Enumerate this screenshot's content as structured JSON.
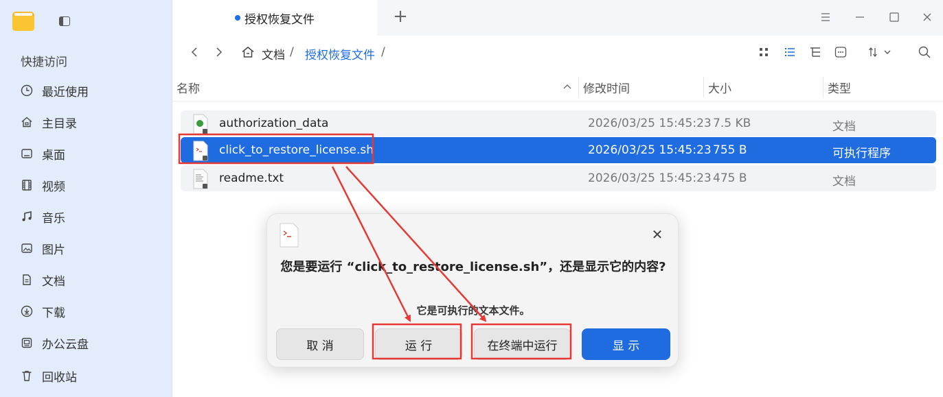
{
  "sidebar": {
    "heading": "快捷访问",
    "items": [
      {
        "label": "最近使用",
        "icon": "clock-icon"
      },
      {
        "label": "主目录",
        "icon": "home-icon"
      },
      {
        "label": "桌面",
        "icon": "desktop-icon"
      },
      {
        "label": "视频",
        "icon": "video-icon"
      },
      {
        "label": "音乐",
        "icon": "music-icon"
      },
      {
        "label": "图片",
        "icon": "picture-icon"
      },
      {
        "label": "文档",
        "icon": "document-icon"
      },
      {
        "label": "下载",
        "icon": "download-icon"
      },
      {
        "label": "办公云盘",
        "icon": "cloud-disk-icon"
      },
      {
        "label": "回收站",
        "icon": "trash-icon"
      }
    ]
  },
  "tabs": [
    {
      "label": "授权恢复文件"
    }
  ],
  "breadcrumb": {
    "items": [
      "文档",
      "授权恢复文件"
    ],
    "separator": "/"
  },
  "columns": {
    "name": "名称",
    "modified": "修改时间",
    "size": "大小",
    "type": "类型"
  },
  "files": [
    {
      "name": "authorization_data",
      "modified": "2026/03/25 15:45:23",
      "size": "7.5 KB",
      "type": "文档",
      "icon": "data-file-icon"
    },
    {
      "name": "click_to_restore_license.sh",
      "modified": "2026/03/25 15:45:23",
      "size": "755 B",
      "type": "可执行程序",
      "icon": "shell-script-icon"
    },
    {
      "name": "readme.txt",
      "modified": "2026/03/25 15:45:23",
      "size": "475 B",
      "type": "文档",
      "icon": "text-file-icon"
    }
  ],
  "dialog": {
    "title": "您是要运行 “click_to_restore_license.sh”，还是显示它的内容?",
    "message": "它是可执行的文本文件。",
    "buttons": {
      "cancel": "取 消",
      "run": "运 行",
      "run_in_terminal": "在终端中运行",
      "display": "显 示"
    }
  },
  "colors": {
    "accent": "#1f6be0",
    "sidebar_bg": "#e3ecfa",
    "annotation_red": "#e53935"
  }
}
